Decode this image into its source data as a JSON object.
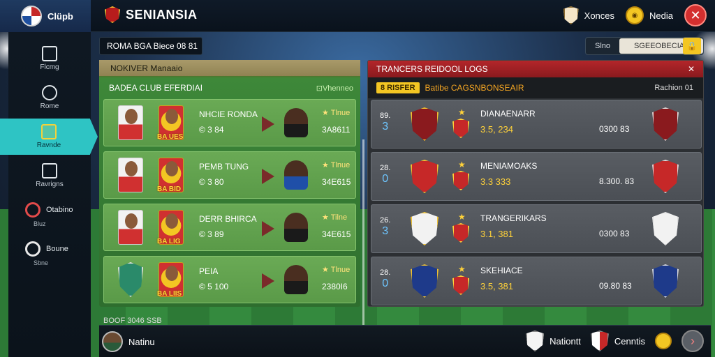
{
  "app": {
    "logo_label": "Clüpb",
    "title": "SENIANSIA"
  },
  "topbar": {
    "club_label": "Xonces",
    "coins_label": "Nedia",
    "coin_symbol": "◉",
    "close_symbol": "✕"
  },
  "sidebar": {
    "items": [
      {
        "label": "Flcmg"
      },
      {
        "label": "Rome"
      },
      {
        "label": "Ravnde"
      },
      {
        "label": "Ravrigns"
      }
    ],
    "extras": [
      {
        "label": "Otabino",
        "sub": "Bluz"
      },
      {
        "label": "Boune",
        "sub": "Sbne"
      }
    ]
  },
  "subheader": {
    "label": "ROMA BGA Biece 08 81"
  },
  "filter": {
    "left_label": "Slno",
    "right_label": "SGEEOBECIAT",
    "lock_symbol": "🔒"
  },
  "left_panel": {
    "header": "NOKIVER Manaaio",
    "subheader": "BADEA CLUB EFERDIAI",
    "tag": "⊡Vhenneo",
    "rows": [
      {
        "name": "NHCIE RONDA",
        "rating": "© 3 84",
        "gold": "BA UES",
        "stars": "★ Tlnue",
        "value": "3A8611",
        "kit": "dark"
      },
      {
        "name": "PEMB TUNG",
        "rating": "© 3 80",
        "gold": "BA BID",
        "stars": "★ Tlnue",
        "value": "34E615",
        "kit": "blue"
      },
      {
        "name": "DERR BHIRCA",
        "rating": "© 3 89",
        "gold": "BA LIG",
        "stars": "★ Tilne",
        "value": "34E615",
        "kit": "dark"
      },
      {
        "name": "PEIA",
        "rating": "© 5 100",
        "gold": "BA LIIS",
        "stars": "★ Tlnue",
        "value": "2380I6",
        "kit": "dark"
      }
    ],
    "footer": "BOOF 3046 SSB"
  },
  "right_panel": {
    "header": "TRANCERS REIDOOL LOGS",
    "badge": "8 RISFER",
    "subtitle": "Batibe CAGSNBONSEAIR",
    "right_label": "Rachion 01",
    "rows": [
      {
        "idx_top": "89.",
        "idx_big": "3",
        "name": "DIANAENARR",
        "stat": "3.5, 234",
        "value": "0300 83",
        "crest": "#8a1a1e"
      },
      {
        "idx_top": "28.",
        "idx_big": "0",
        "name": "MENIAMOAKS",
        "stat": "3.3 333",
        "value": "8.300. 83",
        "crest": "#c62828"
      },
      {
        "idx_top": "26.",
        "idx_big": "3",
        "name": "TRANGERIKARS",
        "stat": "3.1, 381",
        "value": "0300 83",
        "crest": "#f2f2f2"
      },
      {
        "idx_top": "28.",
        "idx_big": "0",
        "name": "SKEHIACE",
        "stat": "3.5, 381",
        "value": "09.80 83",
        "crest": "#1e3a8a"
      }
    ],
    "close_symbol": "✕",
    "star_symbol": "★"
  },
  "bottombar": {
    "user_label": "Natinu",
    "team1_label": "Nationtt",
    "team2_label": "Cenntis",
    "next_symbol": "›"
  }
}
